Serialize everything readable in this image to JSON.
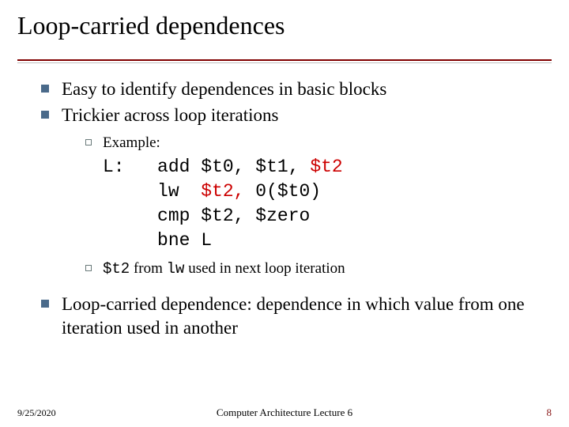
{
  "title": "Loop-carried dependences",
  "bullets": {
    "b1": "Easy to identify dependences in basic blocks",
    "b2": "Trickier across loop iterations",
    "b3": "Loop-carried dependence: dependence in which value from one iteration used in another"
  },
  "sub": {
    "example_label": "Example:",
    "note_pre": "$t2",
    "note_mid1": " from ",
    "note_code2": "lw",
    "note_mid2": " used in next loop iteration"
  },
  "code": {
    "l1_label": "L:",
    "l1_op": "add",
    "l1_a1": "$t0,",
    "l1_a2": "$t1,",
    "l1_a3": "$t2",
    "l2_op": "lw",
    "l2_a1": "$t2,",
    "l2_a2": "0($t0)",
    "l3_op": "cmp",
    "l3_a1": "$t2,",
    "l3_a2": "$zero",
    "l4_op": "bne",
    "l4_a1": "L"
  },
  "footer": {
    "date": "9/25/2020",
    "center": "Computer Architecture Lecture 6",
    "page": "8"
  }
}
